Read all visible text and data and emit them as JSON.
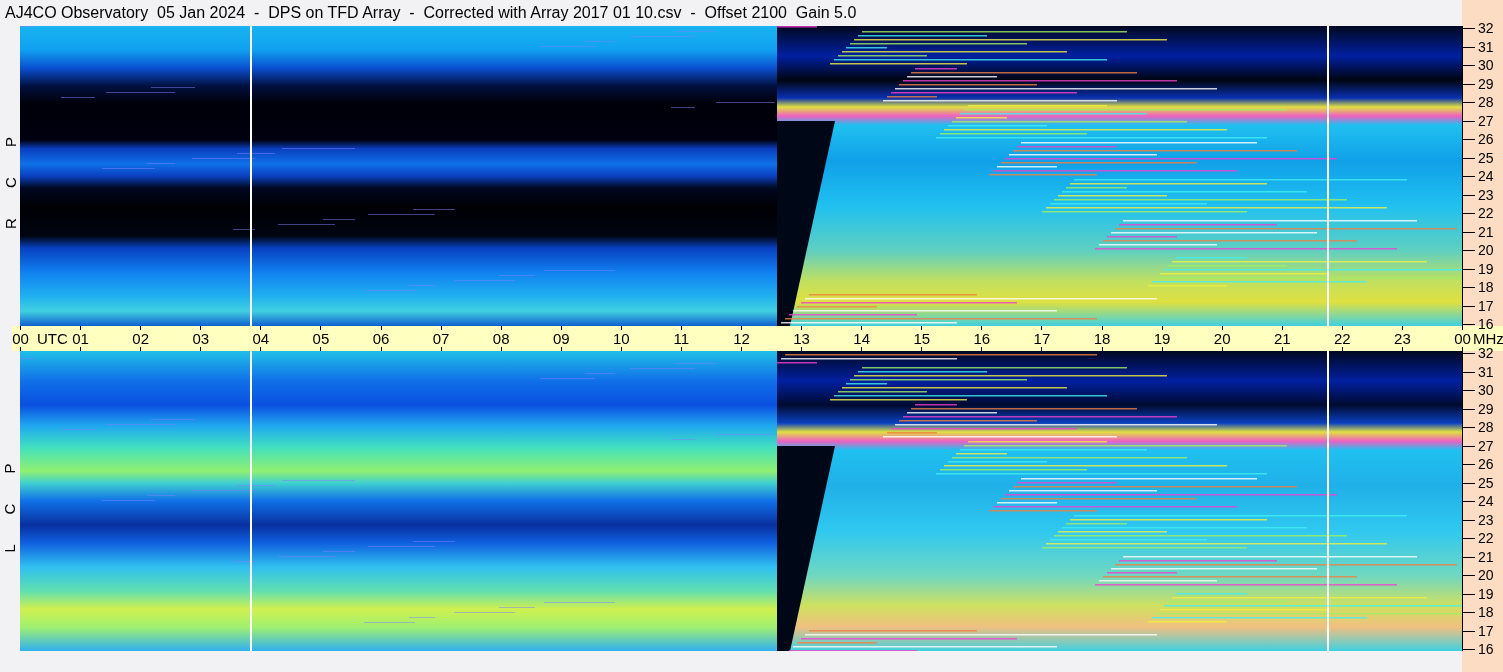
{
  "title": "AJ4CO Observatory  05 Jan 2024  -  DPS on TFD Array  -  Corrected with Array 2017 01 10.csv  -  Offset 2100  Gain 5.0",
  "panels": [
    {
      "label": "R C P",
      "frequency_ticks": [
        "32",
        "31",
        "30",
        "29",
        "28",
        "27",
        "26",
        "25",
        "24",
        "23",
        "22",
        "21",
        "20",
        "19",
        "18",
        "17",
        "16"
      ]
    },
    {
      "label": "L C P",
      "frequency_ticks": [
        "32",
        "31",
        "30",
        "29",
        "28",
        "27",
        "26",
        "25",
        "24",
        "23",
        "22",
        "21",
        "20",
        "19",
        "18",
        "17",
        "16"
      ]
    }
  ],
  "time_axis": {
    "ticks": [
      "00",
      "01",
      "02",
      "03",
      "04",
      "05",
      "06",
      "07",
      "08",
      "09",
      "10",
      "11",
      "12",
      "13",
      "14",
      "15",
      "16",
      "17",
      "18",
      "19",
      "20",
      "21",
      "22",
      "23",
      "00"
    ],
    "time_unit": "UTC",
    "frequency_unit": "MHz"
  }
}
